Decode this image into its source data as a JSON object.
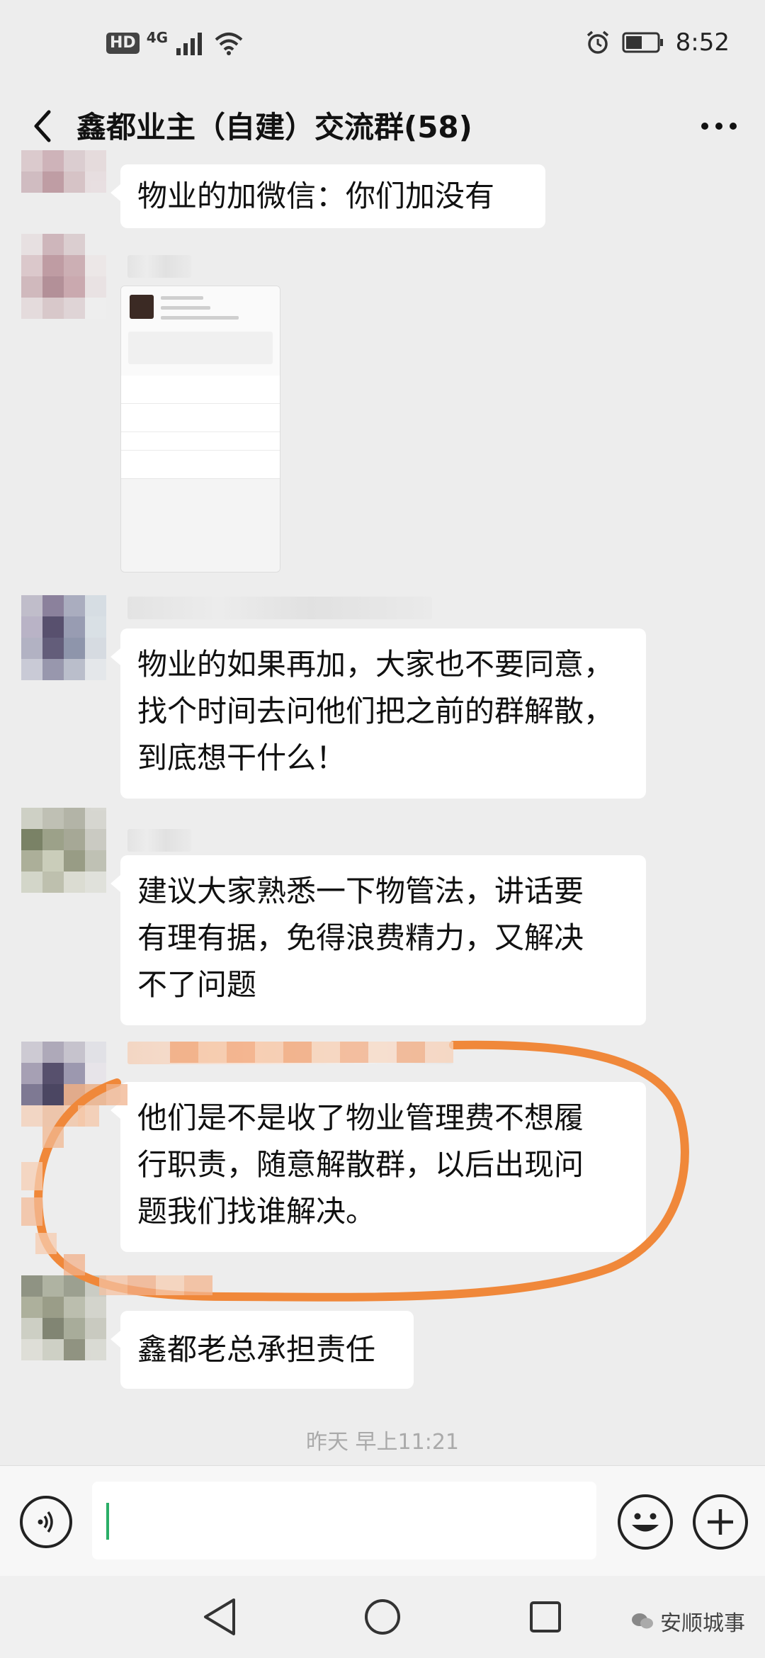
{
  "status_bar": {
    "hd": "HD",
    "network": "4G",
    "time": "8:52"
  },
  "chat": {
    "title": "鑫都业主（自建）交流群(58)"
  },
  "messages": [
    {
      "text": "物业的加微信：你们加没有"
    },
    {
      "type": "image",
      "caption": "profile-card-screenshot"
    },
    {
      "lines": [
        "物业的如果再加，大家也不要同意，",
        "找个时间去问他们把之前的群解散，",
        "到底想干什么！"
      ]
    },
    {
      "lines": [
        "建议大家熟悉一下物管法，讲话要",
        "有理有据，免得浪费精力，又解决",
        "不了问题"
      ]
    },
    {
      "lines": [
        "他们是不是收了物业管理费不想履",
        "行职责，随意解散群，以后出现问",
        "题我们找谁解决。"
      ]
    },
    {
      "text": "鑫都老总承担责任"
    }
  ],
  "timestamp": "昨天 早上11:21",
  "watermark": "安顺城事",
  "colors": {
    "background": "#ededed",
    "bubble": "#ffffff",
    "highlight_circle": "#f0883a",
    "caret": "#2aae67"
  },
  "icons": {
    "back": "chevron-left-icon",
    "more": "more-dots-icon",
    "voice": "voice-icon",
    "emoji": "emoji-icon",
    "plus": "plus-icon"
  }
}
